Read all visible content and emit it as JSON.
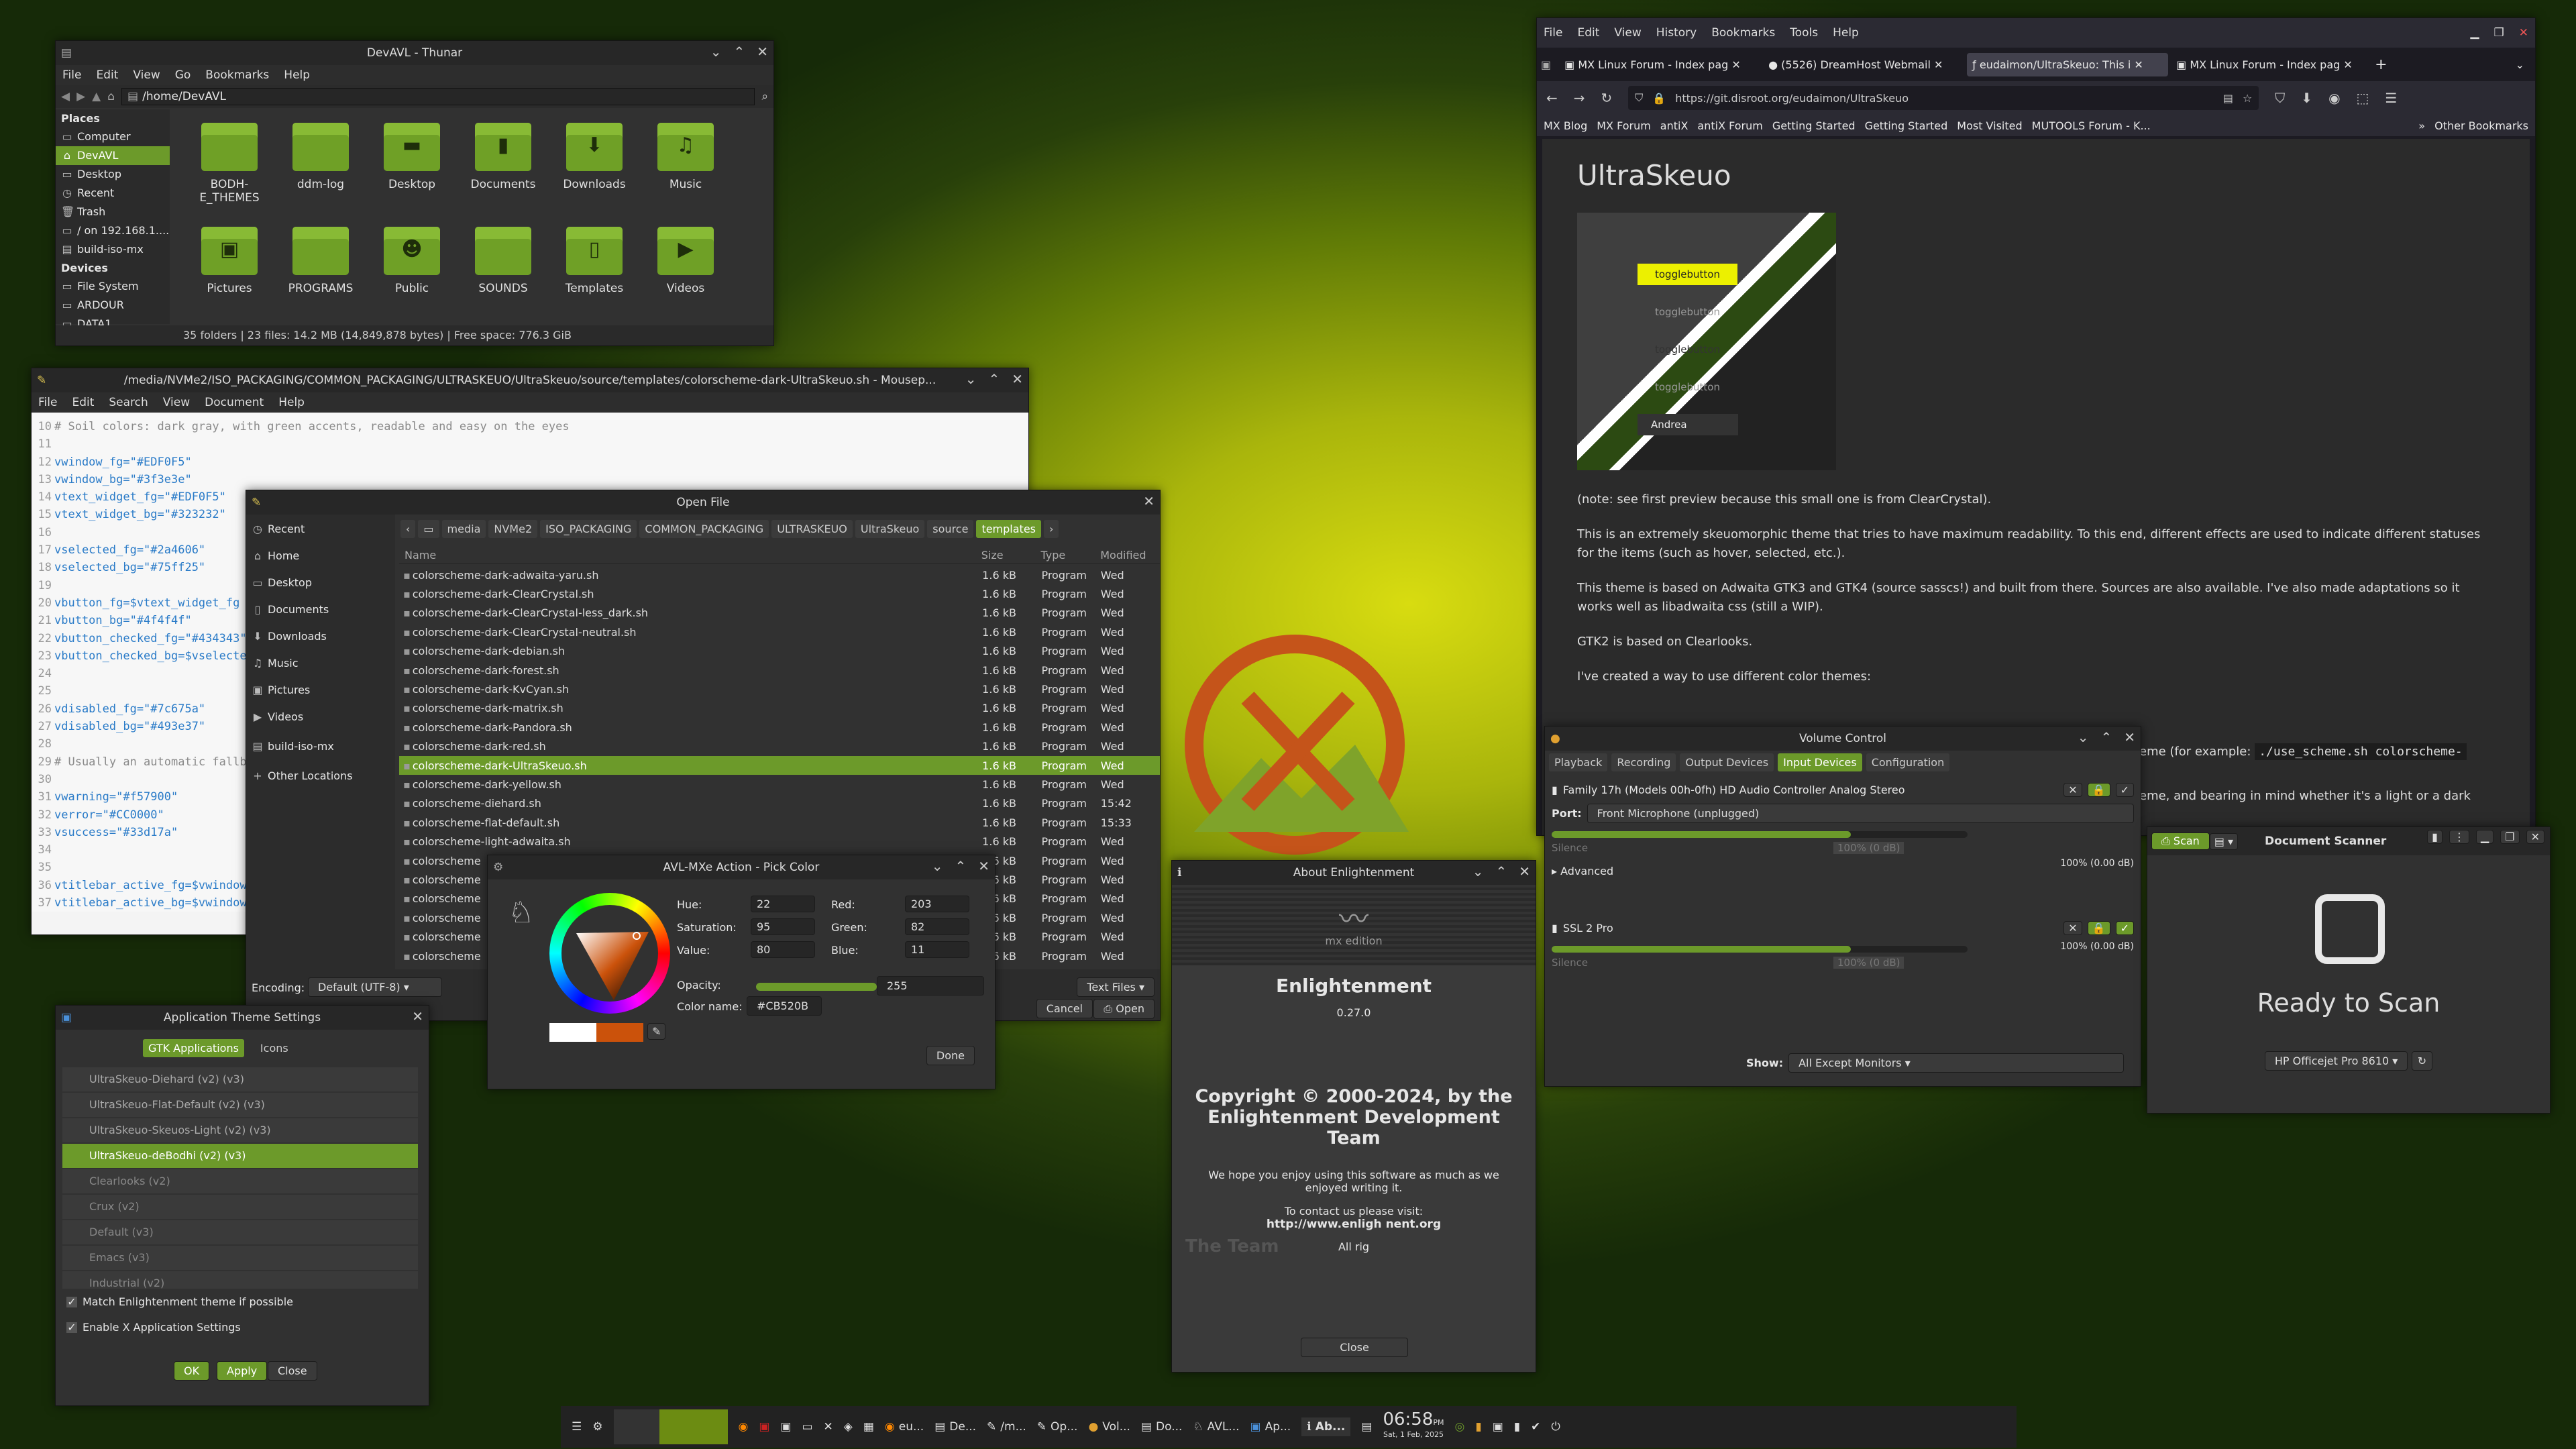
{
  "thunar": {
    "title": "DevAVL - Thunar",
    "menu": [
      "File",
      "Edit",
      "View",
      "Go",
      "Bookmarks",
      "Help"
    ],
    "path": "/home/DevAVL",
    "places_header": "Places",
    "places": [
      "Computer",
      "DevAVL",
      "Desktop",
      "Recent",
      "Trash",
      "/ on 192.168.1....",
      "build-iso-mx"
    ],
    "devices_header": "Devices",
    "devices": [
      "File System",
      "ARDOUR",
      "DATA1"
    ],
    "folders": [
      "BODH-E_THEMES",
      "ddm-log",
      "Desktop",
      "Documents",
      "Downloads",
      "Music",
      "Pictures",
      "PROGRAMS",
      "Public",
      "SOUNDS",
      "Templates",
      "Videos"
    ],
    "status": "35 folders  |  23 files: 14.2 MB (14,849,878 bytes)  |  Free space: 776.3 GiB"
  },
  "mousepad": {
    "title": "/media/NVMe2/ISO_PACKAGING/COMMON_PACKAGING/ULTRASKEUO/UltraSkeuo/source/templates/colorscheme-dark-UltraSkeuo.sh - Mousep...",
    "menu": [
      "File",
      "Edit",
      "Search",
      "View",
      "Document",
      "Help"
    ],
    "lines": [
      {
        "n": "10",
        "t": "# Soil colors: dark gray, with green accents, readable and easy on the eyes",
        "c": "#8a8a8a"
      },
      {
        "n": "11",
        "t": "",
        "c": "#333"
      },
      {
        "n": "12",
        "t": "vwindow_fg=\"#EDF0F5\"",
        "c": "#2a7bc8"
      },
      {
        "n": "13",
        "t": "vwindow_bg=\"#3f3e3e\"",
        "c": "#2a7bc8"
      },
      {
        "n": "14",
        "t": "vtext_widget_fg=\"#EDF0F5\"",
        "c": "#2a7bc8"
      },
      {
        "n": "15",
        "t": "vtext_widget_bg=\"#323232\"",
        "c": "#2a7bc8"
      },
      {
        "n": "16",
        "t": "",
        "c": "#333"
      },
      {
        "n": "17",
        "t": "vselected_fg=\"#2a4606\"",
        "c": "#2a7bc8"
      },
      {
        "n": "18",
        "t": "vselected_bg=\"#75ff25\"",
        "c": "#2a7bc8"
      },
      {
        "n": "19",
        "t": "",
        "c": "#333"
      },
      {
        "n": "20",
        "t": "vbutton_fg=$vtext_widget_fg",
        "c": "#2a7bc8"
      },
      {
        "n": "21",
        "t": "vbutton_bg=\"#4f4f4f\"",
        "c": "#2a7bc8"
      },
      {
        "n": "22",
        "t": "vbutton_checked_fg=\"#434343\"",
        "c": "#2a7bc8"
      },
      {
        "n": "23",
        "t": "vbutton_checked_bg=$vselected_bg",
        "c": "#2a7bc8"
      },
      {
        "n": "24",
        "t": "",
        "c": "#333"
      },
      {
        "n": "25",
        "t": "",
        "c": "#333"
      },
      {
        "n": "26",
        "t": "vdisabled_fg=\"#7c675a\"",
        "c": "#2a7bc8"
      },
      {
        "n": "27",
        "t": "vdisabled_bg=\"#493e37\"",
        "c": "#2a7bc8"
      },
      {
        "n": "28",
        "t": "",
        "c": "#333"
      },
      {
        "n": "29",
        "t": "# Usually an automatic fallback",
        "c": "#8a8a8a"
      },
      {
        "n": "30",
        "t": "",
        "c": "#333"
      },
      {
        "n": "31",
        "t": "vwarning=\"#f57900\"",
        "c": "#2a7bc8"
      },
      {
        "n": "32",
        "t": "verror=\"#CC0000\"",
        "c": "#2a7bc8"
      },
      {
        "n": "33",
        "t": "vsuccess=\"#33d17a\"",
        "c": "#2a7bc8"
      },
      {
        "n": "34",
        "t": "",
        "c": "#333"
      },
      {
        "n": "35",
        "t": "",
        "c": "#333"
      },
      {
        "n": "36",
        "t": "vtitlebar_active_fg=$vwindow_fg",
        "c": "#2a7bc8"
      },
      {
        "n": "37",
        "t": "vtitlebar_active_bg=$vwindow_bg",
        "c": "#2a7bc8"
      }
    ]
  },
  "openfile": {
    "title": "Open File",
    "places": [
      "Recent",
      "Home",
      "Desktop",
      "Documents",
      "Downloads",
      "Music",
      "Pictures",
      "Videos",
      "build-iso-mx",
      "Other Locations"
    ],
    "crumbs": [
      "media",
      "NVMe2",
      "ISO_PACKAGING",
      "COMMON_PACKAGING",
      "ULTRASKEUO",
      "UltraSkeuo",
      "source",
      "templates"
    ],
    "cols": [
      "Name",
      "Size",
      "Type",
      "Modified"
    ],
    "files": [
      [
        "colorscheme-dark-adwaita-yaru.sh",
        "1.6 kB",
        "Program",
        "Wed"
      ],
      [
        "colorscheme-dark-ClearCrystal.sh",
        "1.6 kB",
        "Program",
        "Wed"
      ],
      [
        "colorscheme-dark-ClearCrystal-less_dark.sh",
        "1.6 kB",
        "Program",
        "Wed"
      ],
      [
        "colorscheme-dark-ClearCrystal-neutral.sh",
        "1.6 kB",
        "Program",
        "Wed"
      ],
      [
        "colorscheme-dark-debian.sh",
        "1.6 kB",
        "Program",
        "Wed"
      ],
      [
        "colorscheme-dark-forest.sh",
        "1.6 kB",
        "Program",
        "Wed"
      ],
      [
        "colorscheme-dark-KvCyan.sh",
        "1.6 kB",
        "Program",
        "Wed"
      ],
      [
        "colorscheme-dark-matrix.sh",
        "1.6 kB",
        "Program",
        "Wed"
      ],
      [
        "colorscheme-dark-Pandora.sh",
        "1.6 kB",
        "Program",
        "Wed"
      ],
      [
        "colorscheme-dark-red.sh",
        "1.6 kB",
        "Program",
        "Wed"
      ],
      [
        "colorscheme-dark-UltraSkeuo.sh",
        "1.6 kB",
        "Program",
        "Wed"
      ],
      [
        "colorscheme-dark-yellow.sh",
        "1.6 kB",
        "Program",
        "Wed"
      ],
      [
        "colorscheme-diehard.sh",
        "1.6 kB",
        "Program",
        "15:42"
      ],
      [
        "colorscheme-flat-default.sh",
        "1.6 kB",
        "Program",
        "15:33"
      ],
      [
        "colorscheme-light-adwaita.sh",
        "1.6 kB",
        "Program",
        "Wed"
      ],
      [
        "colorscheme",
        "1.6 kB",
        "Program",
        "Wed"
      ],
      [
        "colorscheme",
        "1.6 kB",
        "Program",
        "Wed"
      ],
      [
        "colorscheme",
        "1.6 kB",
        "Program",
        "Wed"
      ],
      [
        "colorscheme",
        "1.6 kB",
        "Program",
        "Wed"
      ],
      [
        "colorscheme",
        "1.6 kB",
        "Program",
        "Wed"
      ],
      [
        "colorscheme",
        "1.6 kB",
        "Program",
        "Wed"
      ]
    ],
    "selected_index": 10,
    "encoding_label": "Encoding:",
    "encoding": "Default (UTF-8)",
    "filter": "Text Files",
    "cancel": "Cancel",
    "open": "Open"
  },
  "picker": {
    "title": "AVL-MXe Action - Pick Color",
    "hsv": [
      {
        "label": "Hue:",
        "value": "22"
      },
      {
        "label": "Saturation:",
        "value": "95"
      },
      {
        "label": "Value:",
        "value": "80"
      }
    ],
    "rgb": [
      {
        "label": "Red:",
        "value": "203"
      },
      {
        "label": "Green:",
        "value": "82"
      },
      {
        "label": "Blue:",
        "value": "11"
      }
    ],
    "opacity_label": "Opacity:",
    "opacity": "255",
    "colorname_label": "Color name:",
    "colorname": "#CB520B",
    "done": "Done",
    "color": "#CB520B"
  },
  "theme": {
    "title": "Application Theme Settings",
    "tabs": [
      "GTK Applications",
      "Icons"
    ],
    "items": [
      "UltraSkeuo-Diehard (v2) (v3)",
      "UltraSkeuo-Flat-Default (v2) (v3)",
      "UltraSkeuo-Skeuos-Light (v2) (v3)",
      "UltraSkeuo-deBodhi (v2) (v3)",
      "Clearlooks (v2)",
      "Crux (v2)",
      "Default (v3)",
      "Emacs (v3)",
      "Industrial (v2)"
    ],
    "selected_index": 3,
    "checks": [
      "Match Enlightenment theme if possible",
      "Enable X Application Settings"
    ],
    "buttons": [
      "OK",
      "Apply",
      "Close"
    ]
  },
  "about": {
    "title": "About Enlightenment",
    "logo_text": "mx edition",
    "name": "Enlightenment",
    "version": "0.27.0",
    "copyright": "Copyright © 2000-2024, by the Enlightenment Development Team",
    "hope": "We hope you enjoy using this software as much as we enjoyed writing it.",
    "contact": "To contact us please visit:",
    "url": "http://www.enligh      nent.org",
    "rights": "All rig",
    "team": "The Team",
    "close": "Close"
  },
  "volume": {
    "title": "Volume Control",
    "tabs": [
      "Playback",
      "Recording",
      "Output Devices",
      "Input Devices",
      "Configuration"
    ],
    "dev1": "Family 17h (Models 00h-0fh) HD Audio Controller Analog Stereo",
    "port_label": "Port:",
    "port": "Front Microphone (unplugged)",
    "pct": "100% (0.00 dB)",
    "silence": "Silence",
    "mid": "100% (0 dB)",
    "advanced": "Advanced",
    "dev2": "SSL 2 Pro",
    "show_label": "Show:",
    "show": "All Except Monitors"
  },
  "scanner": {
    "title": "Document Scanner",
    "scan": "Scan",
    "ready": "Ready to Scan",
    "device": "HP Officejet Pro 8610"
  },
  "browser": {
    "menu": [
      "File",
      "Edit",
      "View",
      "History",
      "Bookmarks",
      "Tools",
      "Help"
    ],
    "tabs": [
      "MX Linux Forum - Index pag",
      "(5526) DreamHost Webmail",
      "eudaimon/UltraSkeuo: This i",
      "MX Linux Forum - Index pag"
    ],
    "url": "https://git.disroot.org/eudaimon/UltraSkeuo",
    "bookmarks": [
      "MX Blog",
      "MX Forum",
      "antiX",
      "antiX Forum",
      "Getting Started",
      "Getting Started",
      "Most Visited",
      "MUTOOLS Forum - K..."
    ],
    "other_bookmarks": "Other Bookmarks",
    "heading": "UltraSkeuo",
    "preview_labels": [
      "togglebutton",
      "togglebutton",
      "togglebutton",
      "togglebutton",
      "Andrea"
    ],
    "paras": [
      "(note: see first preview because this small one is from ClearCrystal).",
      "This is an extremely skeuomorphic theme that tries to have maximum readability. To this end, different effects are used to indicate different statuses for the items (such as hover, selected, etc.).",
      "This theme is based on Adwaita GTK3 and GTK4 (source sasscs!) and built from there. Sources are also available. I've also made adaptations so it works well as libadwaita css (still a WIP).",
      "GTK2 is based on Clearlooks.",
      "I've created a way to use different color themes:"
    ],
    "partial1": "eme  (for example:",
    "code1": "./use_scheme.sh colorscheme-",
    "partial2": "eme, and bearing in mind whether it's a light or a dark"
  },
  "taskbar": {
    "items": [
      "eu...",
      "De...",
      "/m...",
      "Op...",
      "Vol...",
      "Do...",
      "AVL...",
      "Ap...",
      "Ab..."
    ],
    "time": "06:58",
    "ampm": "PM",
    "date": "Sat, 1 Feb, 2025"
  },
  "colors": {
    "accent": "#6c9a2a",
    "selection": "#6c9a2a",
    "bg": "#313131"
  }
}
